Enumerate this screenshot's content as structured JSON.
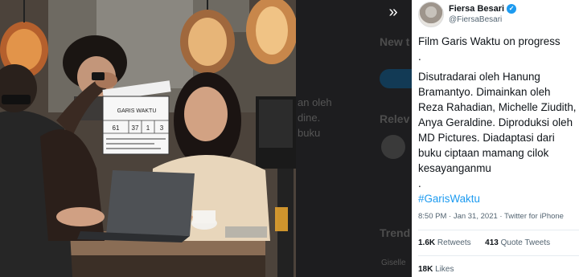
{
  "viewer": {
    "expand_icon": "chevrons-right-icon"
  },
  "background_page": {
    "ghost_1": "New t",
    "ghost_2": "an oleh",
    "ghost_3": "dine.",
    "ghost_4": "buku",
    "ghost_5": "Relev",
    "ghost_6": "Trend",
    "ghost_7": "Giselle"
  },
  "tweet": {
    "author_name": "Fiersa Besari",
    "author_handle": "@FiersaBesari",
    "body": {
      "line1": "Film Garis Waktu on progress\n.",
      "line2": "Disutradarai oleh Hanung Bramantyo. Dimainkan oleh Reza Rahadian, Michelle Ziudith, Anya Geraldine. Diproduksi oleh MD Pictures. Diadaptasi dari buku ciptaan mamang cilok kesayanganmu\n.",
      "hashtag": "#GarisWaktu"
    },
    "time": "8:50 PM · Jan 31, 2021 · Twitter for iPhone",
    "retweets_count": "1.6K",
    "retweets_label": "Retweets",
    "quotes_count": "413",
    "quotes_label": "Quote Tweets",
    "likes_count": "18K",
    "likes_label": "Likes"
  },
  "clapper": {
    "title": "GARIS WAKTU",
    "n1": "61",
    "n2": "37",
    "n3": "1",
    "n4": "3"
  },
  "colors": {
    "accent": "#1d9bf0",
    "text": "#0f1419",
    "muted": "#536471"
  }
}
